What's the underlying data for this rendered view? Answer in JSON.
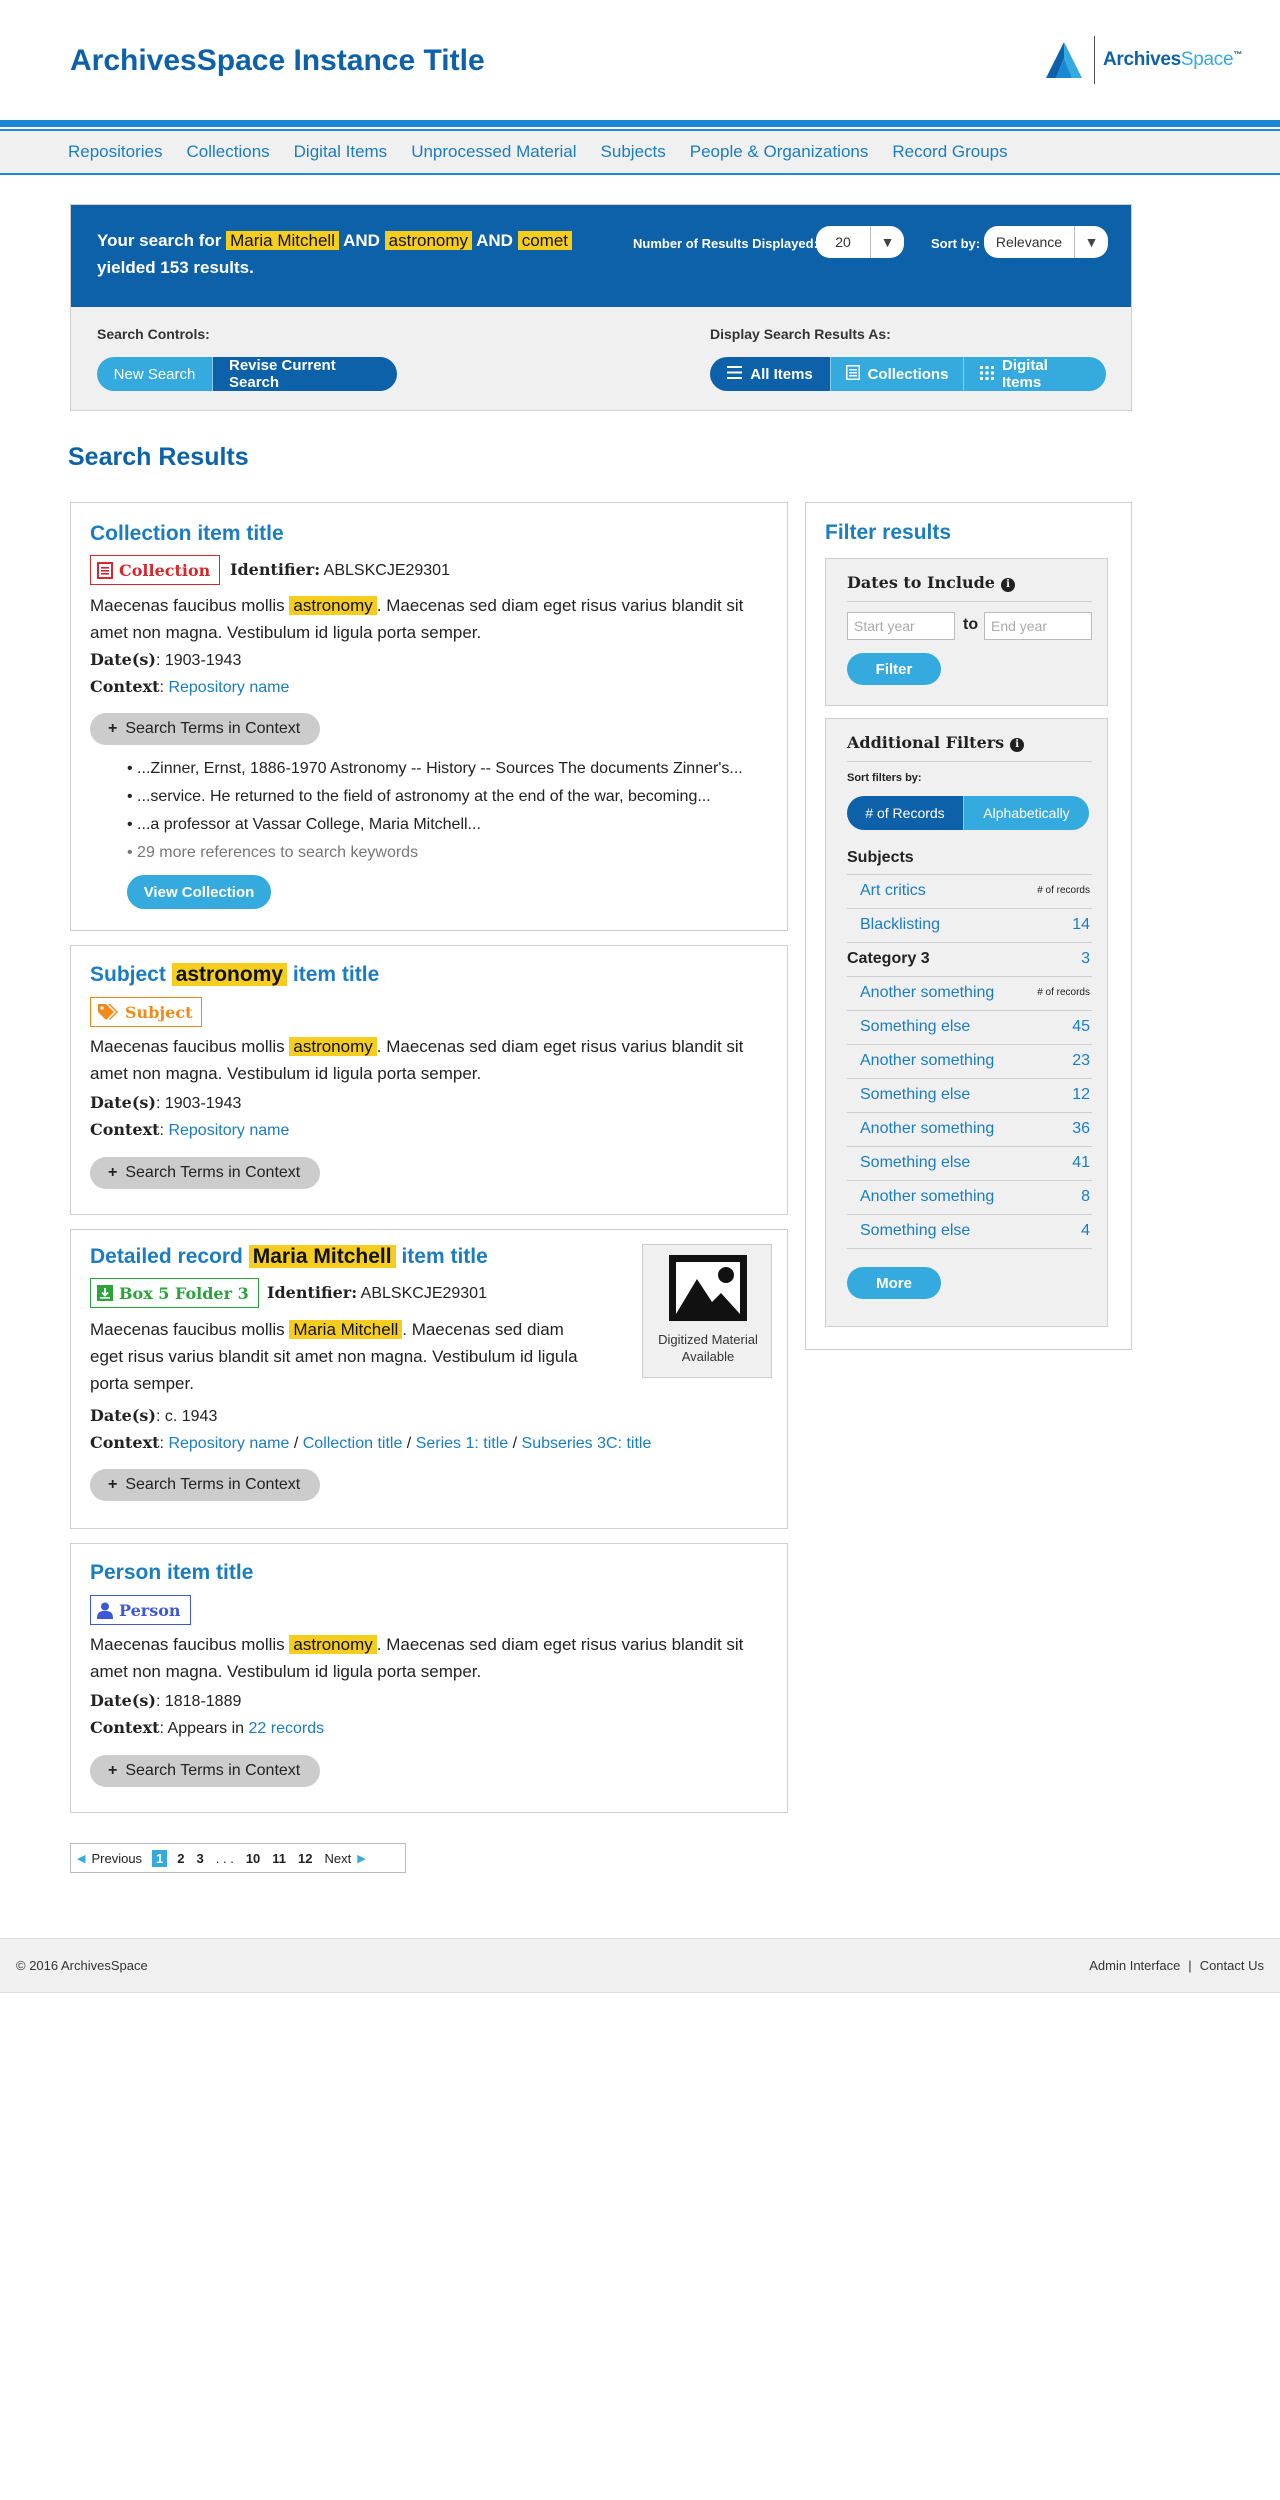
{
  "site": {
    "title": "ArchivesSpace Instance Title",
    "logo_bold": "Archives",
    "logo_light": "Space",
    "logo_tm": "™"
  },
  "nav": [
    "Repositories",
    "Collections",
    "Digital Items",
    "Unprocessed Material",
    "Subjects",
    "People & Organizations",
    "Record Groups"
  ],
  "search": {
    "prefix": "Your search for",
    "term1": "Maria Mitchell",
    "and1": "AND",
    "term2": "astronomy",
    "and2": "AND",
    "term3": "comet",
    "suffix": "yielded 153 results.",
    "num_results_label": "Number of Results Displayed:",
    "num_results_value": "20",
    "sort_label": "Sort by:",
    "sort_value": "Relevance",
    "controls_label": "Search Controls:",
    "new_search": "New Search",
    "revise_search": "Revise Current Search",
    "display_label": "Display Search Results As:",
    "display_all": "All Items",
    "display_collections": "Collections",
    "display_digital": "Digital Items"
  },
  "results_heading": "Search Results",
  "results": [
    {
      "title": "Collection item title",
      "badge": "Collection",
      "identifier_label": "Identifier:",
      "identifier": "ABLSKCJE29301",
      "desc_pre": "Maecenas faucibus mollis",
      "desc_hl": "astronomy",
      "desc_post": ". Maecenas sed diam eget risus varius blandit sit",
      "desc_line2": "amet non magna. Vestibulum id ligula porta semper.",
      "dates_label": "Date(s)",
      "dates": ": 1903-1943",
      "context_label": "Context",
      "context": "Repository name",
      "terms_button": "Search Terms in Context",
      "snippets": [
        "...Zinner, Ernst, 1886-1970 Astronomy -- History -- Sources The documents Zinner's...",
        "...service. He returned to the field of astronomy at the end of the war, becoming...",
        "...a professor at Vassar College, Maria Mitchell..."
      ],
      "more_refs": "29 more references to search keywords",
      "view_button": "View Collection"
    },
    {
      "title_pre": "Subject",
      "title_hl": "astronomy",
      "title_post": "item title",
      "badge": "Subject",
      "desc_pre": "Maecenas faucibus mollis",
      "desc_hl": "astronomy",
      "desc_post": ". Maecenas sed diam eget risus varius blandit sit",
      "desc_line2": "amet non magna. Vestibulum id ligula porta semper.",
      "dates_label": "Date(s)",
      "dates": ": 1903-1943",
      "context_label": "Context",
      "context": "Repository name",
      "terms_button": "Search Terms in Context"
    },
    {
      "title_pre": "Detailed record",
      "title_hl": "Maria Mitchell",
      "title_post": "item title",
      "badge": "Box 5 Folder 3",
      "identifier_label": "Identifier:",
      "identifier": "ABLSKCJE29301",
      "desc_pre": "Maecenas faucibus mollis",
      "desc_hl": "Maria Mitchell",
      "desc_post": ". Maecenas sed diam",
      "desc_line2": "eget risus varius blandit sit amet non magna. Vestibulum id ligula",
      "desc_line3": "porta semper.",
      "dates_label": "Date(s)",
      "dates": ": c. 1943",
      "context_label": "Context",
      "context_links": [
        "Repository name",
        "Collection title",
        "Series 1: title",
        "Subseries 3C: title"
      ],
      "digital_caption_1": "Digitized Material",
      "digital_caption_2": "Available",
      "terms_button": "Search Terms in Context"
    },
    {
      "title": "Person item title",
      "badge": "Person",
      "desc_pre": "Maecenas faucibus mollis",
      "desc_hl": "astronomy",
      "desc_post": ". Maecenas sed diam eget risus varius blandit sit",
      "desc_line2": "amet non magna. Vestibulum id ligula porta semper.",
      "dates_label": "Date(s)",
      "dates": ": 1818-1889",
      "context_label": "Context",
      "context_pre": ": Appears in",
      "context": "22 records",
      "terms_button": "Search Terms in Context"
    }
  ],
  "pagination": {
    "previous": "Previous",
    "pages": [
      "1",
      "2",
      "3",
      ". . .",
      "10",
      "11",
      "12"
    ],
    "current": "1",
    "next": "Next"
  },
  "filters": {
    "title": "Filter results",
    "dates_title": "Dates to Include",
    "start_placeholder": "Start year",
    "to": "to",
    "end_placeholder": "End year",
    "filter_button": "Filter",
    "additional_title": "Additional Filters",
    "sort_label": "Sort filters by:",
    "sort_records": "# of Records",
    "sort_alpha": "Alphabetically",
    "subjects_heading": "Subjects",
    "subjects": [
      {
        "label": "Art critics",
        "count": "# of records"
      },
      {
        "label": "Blacklisting",
        "count": "14"
      }
    ],
    "category_label": "Category 3",
    "category_count": "3",
    "category_items": [
      {
        "label": "Another something",
        "count": "# of records"
      },
      {
        "label": "Something else",
        "count": "45"
      },
      {
        "label": "Another something",
        "count": "23"
      },
      {
        "label": "Something else",
        "count": "12"
      },
      {
        "label": "Another something",
        "count": "36"
      },
      {
        "label": "Something else",
        "count": "41"
      },
      {
        "label": "Another something",
        "count": "8"
      },
      {
        "label": "Something else",
        "count": "4"
      }
    ],
    "more_button": "More"
  },
  "footer": {
    "copyright": "© 2016 ArchivesSpace",
    "admin": "Admin Interface",
    "sep": "|",
    "contact": "Contact Us"
  },
  "colors": {
    "primary": "#0d61a8",
    "accent": "#35aadf",
    "highlight": "#f5cd1e",
    "collection": "#d9262c",
    "subject": "#f28a1b",
    "box": "#2aa33a",
    "person": "#3e57d9"
  }
}
